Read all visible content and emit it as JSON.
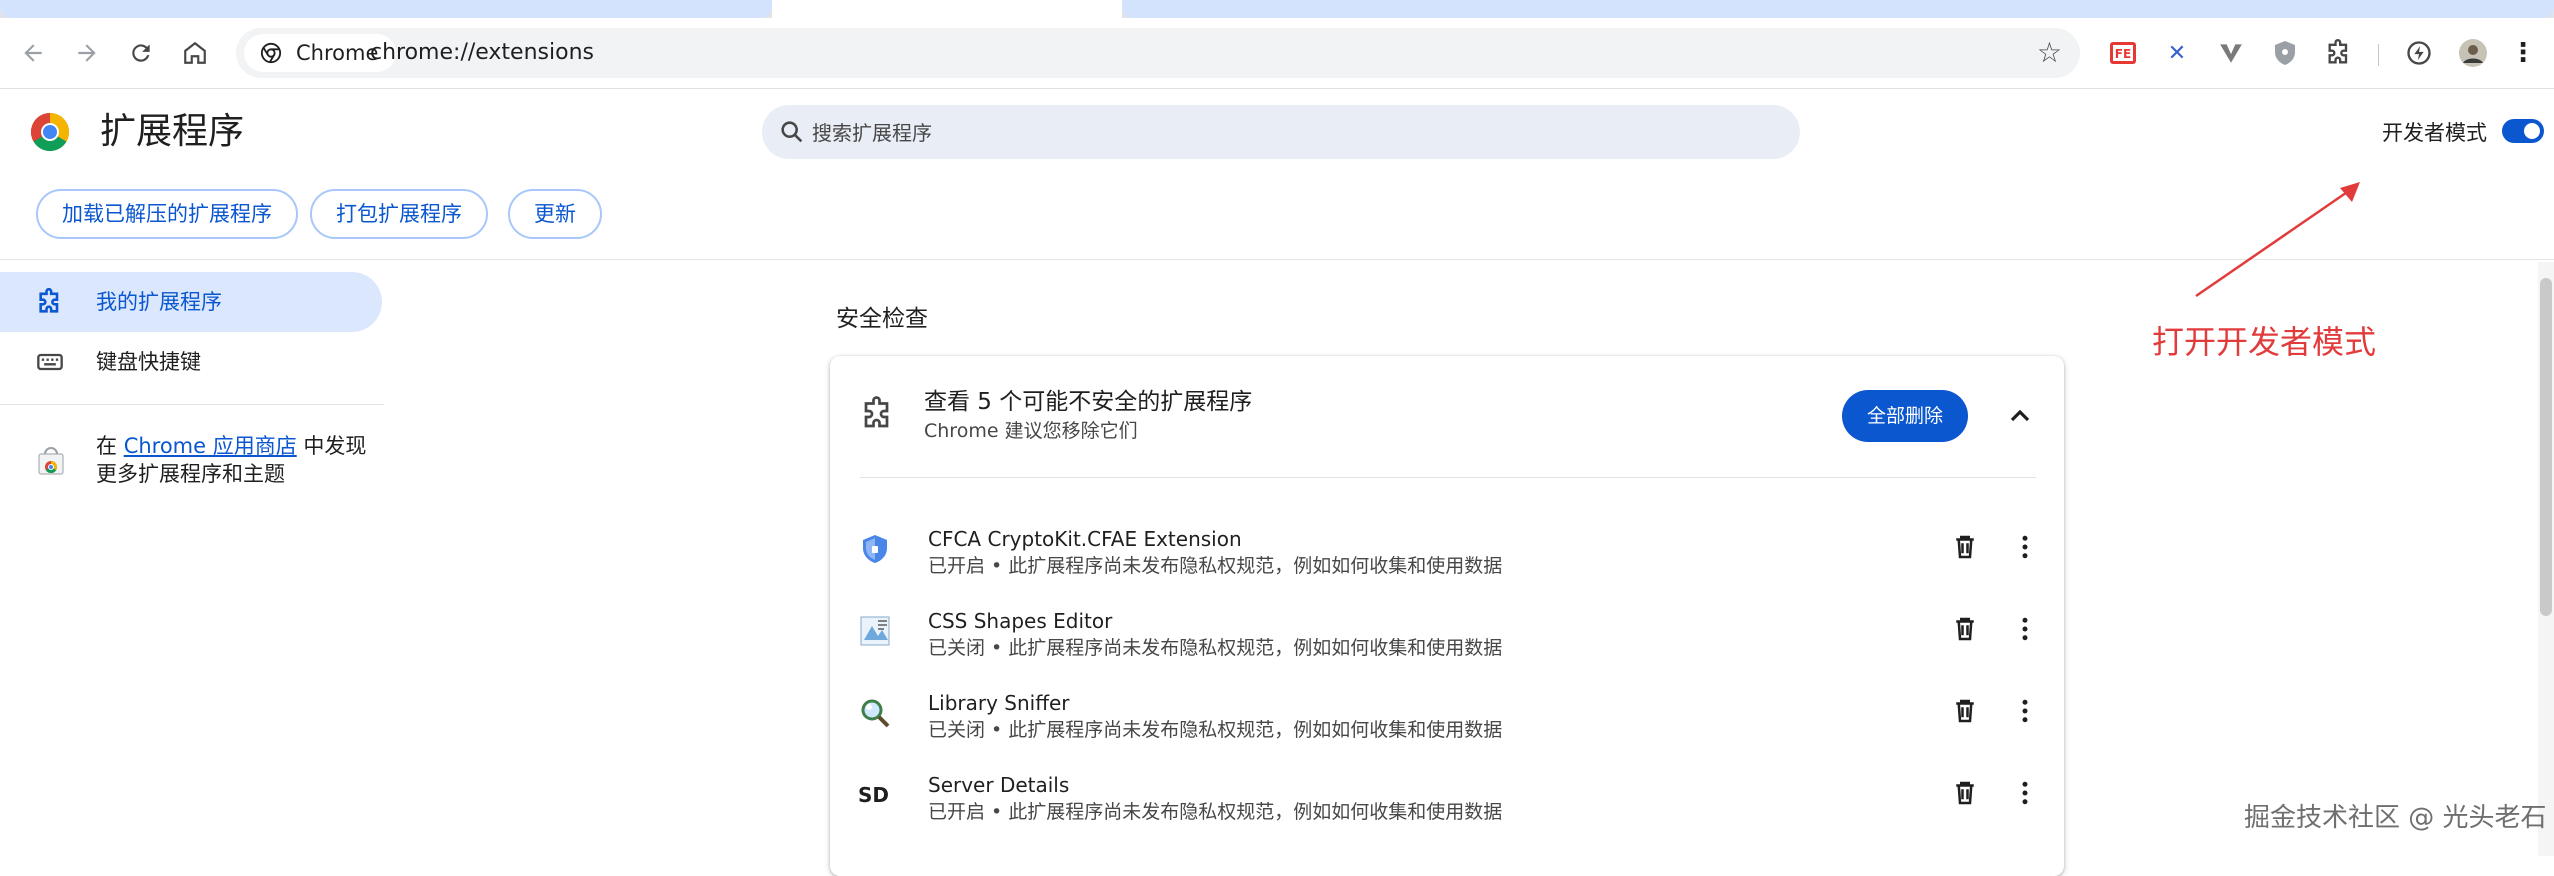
{
  "browser": {
    "chip_label": "Chrome",
    "url": "chrome://extensions"
  },
  "header": {
    "title": "扩展程序",
    "search_placeholder": "搜索扩展程序",
    "dev_mode_label": "开发者模式",
    "dev_mode_on": true,
    "buttons": {
      "load_unpacked": "加载已解压的扩展程序",
      "pack": "打包扩展程序",
      "update": "更新"
    }
  },
  "sidebar": {
    "my_extensions": "我的扩展程序",
    "keyboard_shortcuts": "键盘快捷键",
    "webstore_prefix": "在 ",
    "webstore_link": "Chrome 应用商店",
    "webstore_suffix": " 中发现更多扩展程序和主题"
  },
  "safety": {
    "title": "安全检查",
    "heading": "查看 5 个可能不安全的扩展程序",
    "subheading": "Chrome 建议您移除它们",
    "remove_all": "全部删除",
    "items": [
      {
        "name": "CFCA CryptoKit.CFAE Extension",
        "status": "已开启 • 此扩展程序尚未发布隐私权规范，例如如何收集和使用数据",
        "icon": "shield-icon"
      },
      {
        "name": "CSS Shapes Editor",
        "status": "已关闭 • 此扩展程序尚未发布隐私权规范，例如如何收集和使用数据",
        "icon": "css-shapes-icon"
      },
      {
        "name": "Library Sniffer",
        "status": "已关闭 • 此扩展程序尚未发布隐私权规范，例如如何收集和使用数据",
        "icon": "magnifier-icon"
      },
      {
        "name": "Server Details",
        "status": "已开启 • 此扩展程序尚未发布隐私权规范，例如如何收集和使用数据",
        "icon": "sd-icon",
        "icon_text": "SD"
      }
    ]
  },
  "annotation": {
    "text": "打开开发者模式"
  },
  "watermark": "掘金技术社区 @ 光头老石",
  "colors": {
    "accent": "#0b57d0",
    "annotation": "#e23b3b",
    "selected_bg": "#dbe7fd"
  }
}
